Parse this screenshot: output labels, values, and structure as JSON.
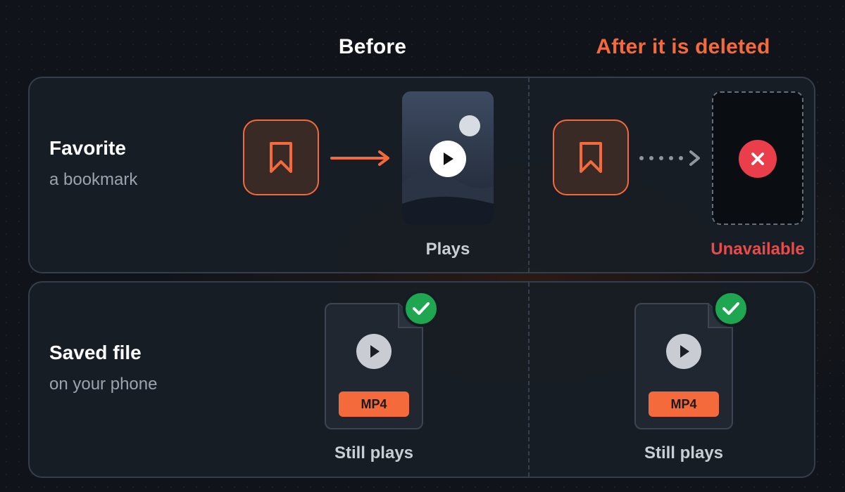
{
  "columns": {
    "before": "Before",
    "after": "After it is deleted"
  },
  "rows": {
    "favorite": {
      "title": "Favorite",
      "subtitle": "a bookmark",
      "before_caption": "Plays",
      "after_caption": "Unavailable"
    },
    "saved": {
      "title": "Saved file",
      "subtitle": "on your phone",
      "badge": "MP4",
      "before_caption": "Still plays",
      "after_caption": "Still plays"
    }
  },
  "icons": {
    "bookmark": "bookmark-icon",
    "play": "play-icon",
    "close": "close-icon",
    "check": "check-icon",
    "arrow": "arrow-right-icon",
    "dotted_arrow": "dotted-arrow-icon"
  },
  "colors": {
    "accent": "#f56a3b",
    "danger": "#ea3f4a",
    "success": "#1fa650",
    "panel": "#181e26",
    "border": "#353e4a"
  }
}
